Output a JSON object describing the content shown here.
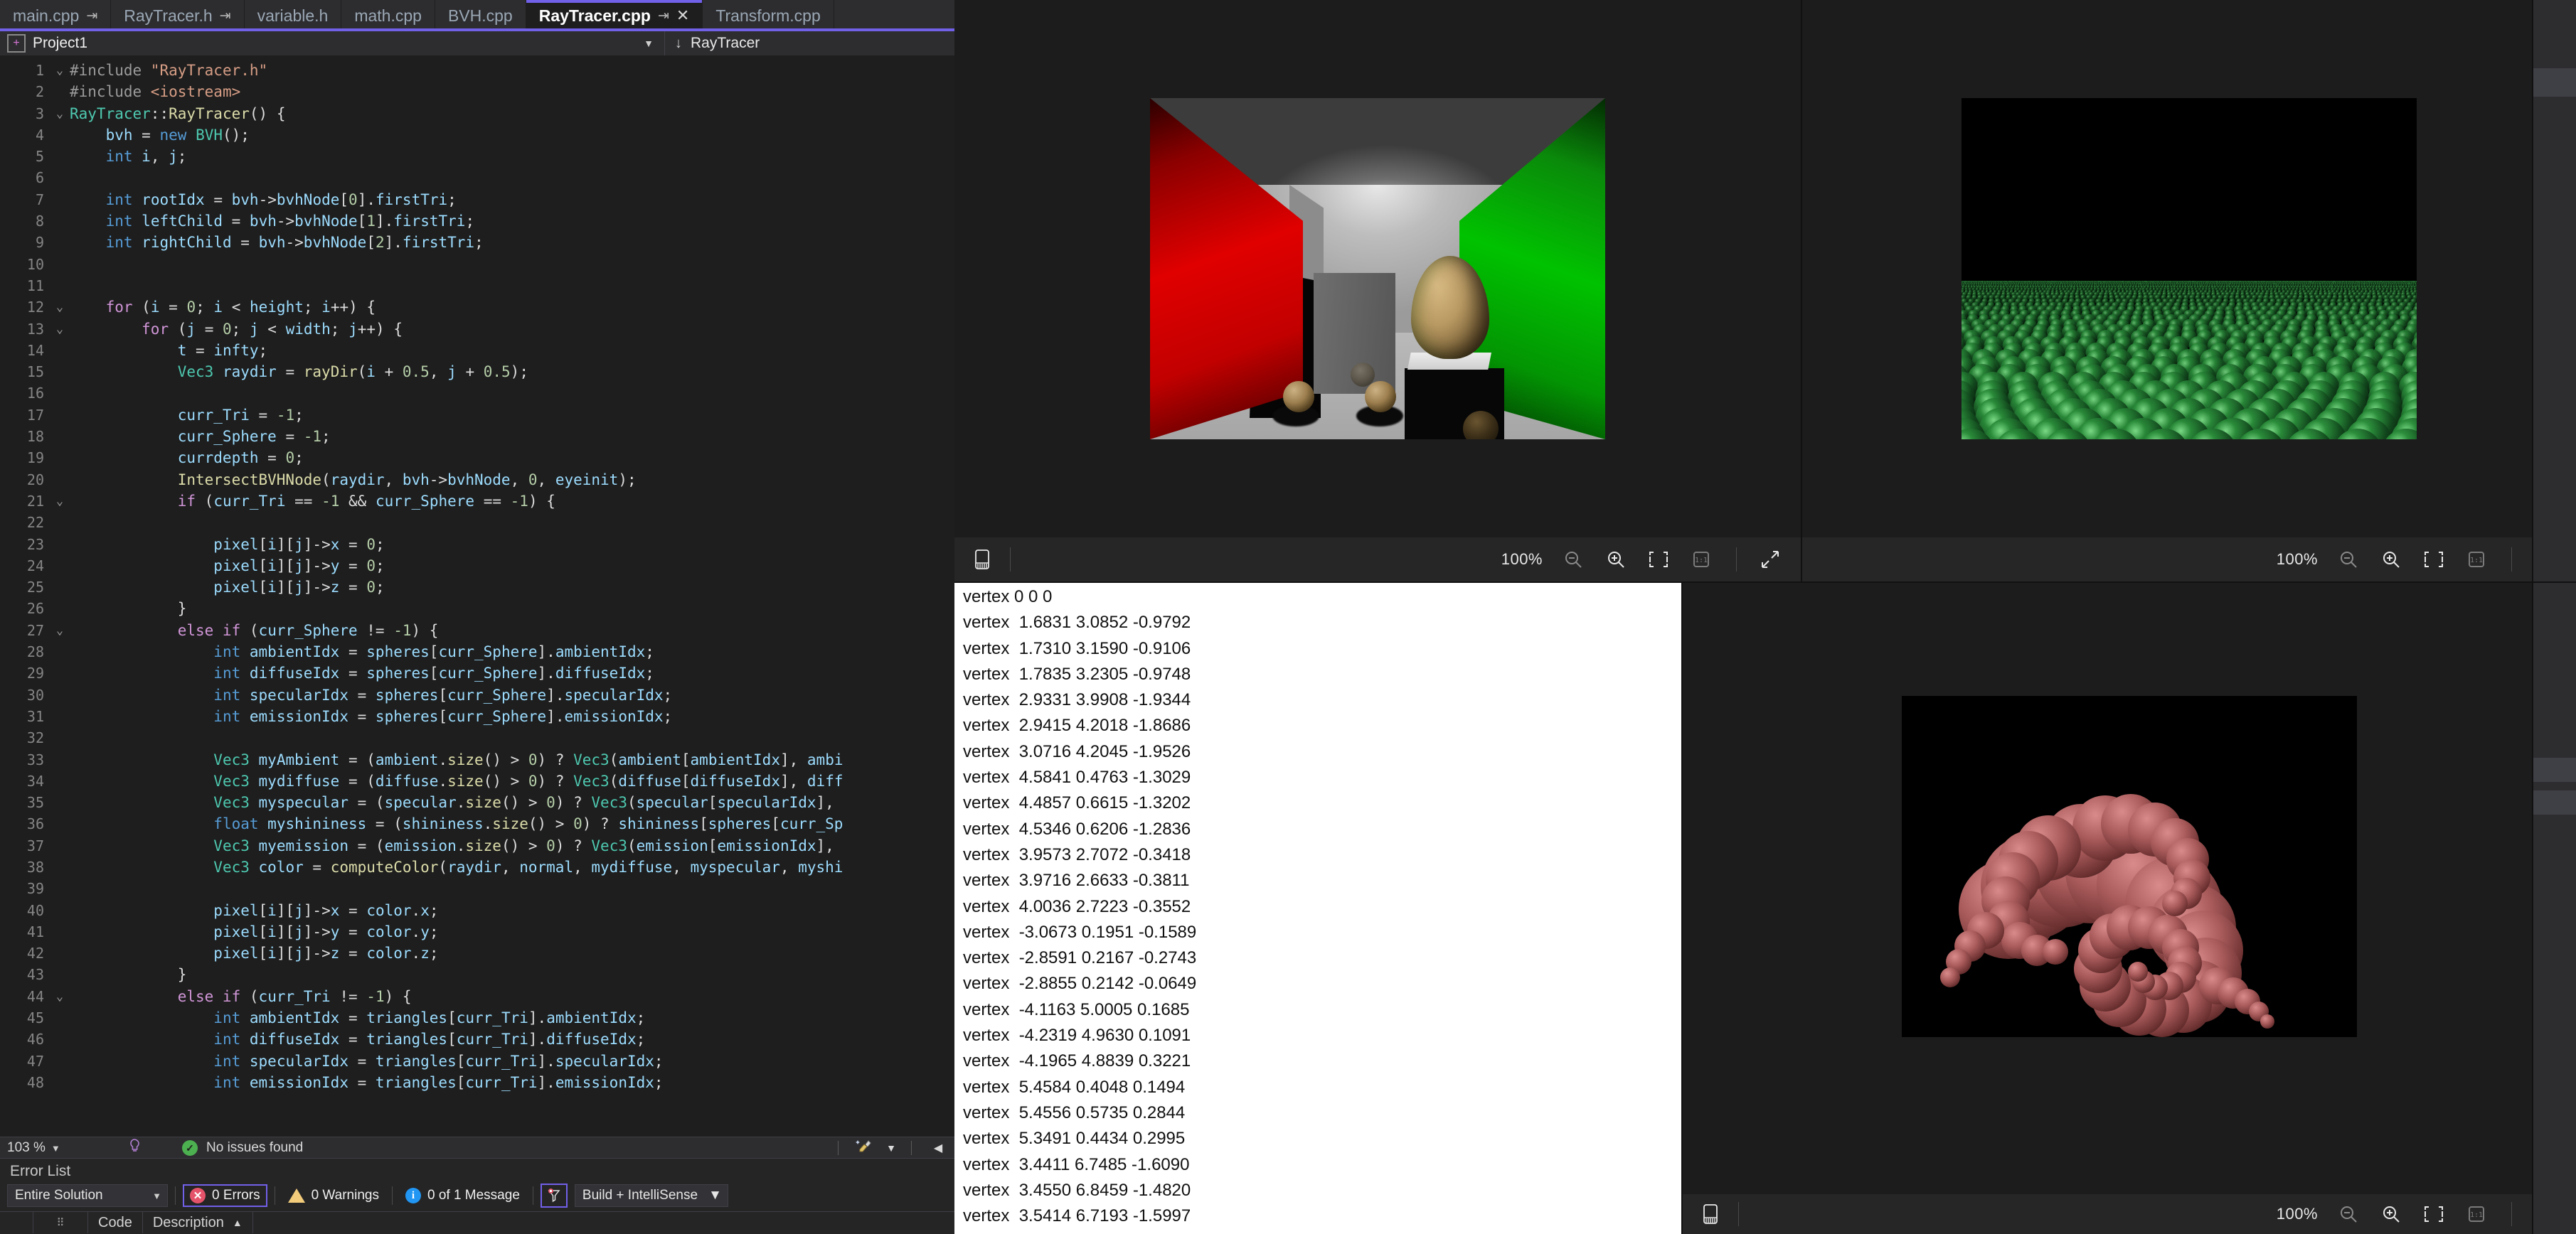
{
  "ide": {
    "tabs": [
      {
        "label": "main.cpp",
        "pinned": true,
        "active": false
      },
      {
        "label": "RayTracer.h",
        "pinned": true,
        "active": false
      },
      {
        "label": "variable.h",
        "pinned": false,
        "active": false
      },
      {
        "label": "math.cpp",
        "pinned": false,
        "active": false
      },
      {
        "label": "BVH.cpp",
        "pinned": false,
        "active": false
      },
      {
        "label": "RayTracer.cpp",
        "pinned": true,
        "active": true,
        "closable": true
      },
      {
        "label": "Transform.cpp",
        "pinned": false,
        "active": false
      }
    ],
    "breadcrumb": {
      "project": "Project1",
      "member": "RayTracer",
      "member_icon": "down-arrow-icon",
      "project_icon": "add-project-icon",
      "dropdown_icon": "chevron-down-icon"
    },
    "status": {
      "zoom": "103 %",
      "zoom_caret": "▾",
      "intellisense_icon": "intellisense-icon",
      "issues_text": "No issues found",
      "ok_icon": "check-icon",
      "broom_icon": "code-cleanup-icon",
      "broom_caret": "▾",
      "nav_back_icon": "chevron-left-icon"
    },
    "error_list": {
      "title": "Error List",
      "scope": "Entire Solution",
      "errors": "0 Errors",
      "warnings": "0 Warnings",
      "messages": "0 of 1 Message",
      "filter_icon": "filter-icon",
      "source": "Build + IntelliSense",
      "columns": [
        "",
        "",
        "Code",
        "Description"
      ],
      "sort_indicator": "▲",
      "rows": []
    },
    "code": {
      "lines": [
        {
          "n": 1,
          "fold": "v",
          "html": "<span class='pp'>#include </span><span class='st'>\"RayTracer.h\"</span>"
        },
        {
          "n": 2,
          "fold": "",
          "html": "<span class='pp'>#include </span><span class='st'>&lt;iostream&gt;</span>"
        },
        {
          "n": 3,
          "fold": "v",
          "html": "<span class='ty'>RayTracer</span><span class='pl'>::</span><span class='fn'>RayTracer</span><span class='pl'>() {</span>"
        },
        {
          "n": 4,
          "fold": "",
          "html": "    <span class='id'>bvh</span> <span class='pl'>= </span><span class='k'>new</span> <span class='ty'>BVH</span><span class='pl'>();</span>"
        },
        {
          "n": 5,
          "fold": "",
          "html": "    <span class='k'>int</span> <span class='id'>i</span><span class='pl'>, </span><span class='id'>j</span><span class='pl'>;</span>"
        },
        {
          "n": 6,
          "fold": "",
          "html": ""
        },
        {
          "n": 7,
          "fold": "",
          "html": "    <span class='k'>int</span> <span class='id'>rootIdx</span> <span class='pl'>= </span><span class='id'>bvh</span><span class='pl'>-&gt;</span><span class='id'>bvhNode</span><span class='pl'>[</span><span class='nu'>0</span><span class='pl'>].</span><span class='id'>firstTri</span><span class='pl'>;</span>"
        },
        {
          "n": 8,
          "fold": "",
          "html": "    <span class='k'>int</span> <span class='id'>leftChild</span> <span class='pl'>= </span><span class='id'>bvh</span><span class='pl'>-&gt;</span><span class='id'>bvhNode</span><span class='pl'>[</span><span class='nu'>1</span><span class='pl'>].</span><span class='id'>firstTri</span><span class='pl'>;</span>"
        },
        {
          "n": 9,
          "fold": "",
          "html": "    <span class='k'>int</span> <span class='id'>rightChild</span> <span class='pl'>= </span><span class='id'>bvh</span><span class='pl'>-&gt;</span><span class='id'>bvhNode</span><span class='pl'>[</span><span class='nu'>2</span><span class='pl'>].</span><span class='id'>firstTri</span><span class='pl'>;</span>"
        },
        {
          "n": 10,
          "fold": "",
          "html": ""
        },
        {
          "n": 11,
          "fold": "",
          "html": ""
        },
        {
          "n": 12,
          "fold": "v",
          "html": "    <span class='kw'>for</span> <span class='pl'>(</span><span class='id'>i</span> <span class='pl'>= </span><span class='nu'>0</span><span class='pl'>; </span><span class='id'>i</span> <span class='pl'>&lt; </span><span class='id'>height</span><span class='pl'>; </span><span class='id'>i</span><span class='pl'>++) {</span>"
        },
        {
          "n": 13,
          "fold": "v",
          "html": "        <span class='kw'>for</span> <span class='pl'>(</span><span class='id'>j</span> <span class='pl'>= </span><span class='nu'>0</span><span class='pl'>; </span><span class='id'>j</span> <span class='pl'>&lt; </span><span class='id'>width</span><span class='pl'>; </span><span class='id'>j</span><span class='pl'>++) {</span>"
        },
        {
          "n": 14,
          "fold": "",
          "html": "            <span class='id'>t</span> <span class='pl'>= </span><span class='id'>infty</span><span class='pl'>;</span>"
        },
        {
          "n": 15,
          "fold": "",
          "html": "            <span class='ty'>Vec3</span> <span class='id'>raydir</span> <span class='pl'>= </span><span class='fn'>rayDir</span><span class='pl'>(</span><span class='id'>i</span> <span class='pl'>+ </span><span class='nu'>0.5</span><span class='pl'>, </span><span class='id'>j</span> <span class='pl'>+ </span><span class='nu'>0.5</span><span class='pl'>);</span>"
        },
        {
          "n": 16,
          "fold": "",
          "html": ""
        },
        {
          "n": 17,
          "fold": "",
          "html": "            <span class='id'>curr_Tri</span> <span class='pl'>= </span><span class='nu'>-1</span><span class='pl'>;</span>"
        },
        {
          "n": 18,
          "fold": "",
          "html": "            <span class='id'>curr_Sphere</span> <span class='pl'>= </span><span class='nu'>-1</span><span class='pl'>;</span>"
        },
        {
          "n": 19,
          "fold": "",
          "html": "            <span class='id'>currdepth</span> <span class='pl'>= </span><span class='nu'>0</span><span class='pl'>;</span>"
        },
        {
          "n": 20,
          "fold": "",
          "html": "            <span class='fn'>IntersectBVHNode</span><span class='pl'>(</span><span class='id'>raydir</span><span class='pl'>, </span><span class='id'>bvh</span><span class='pl'>-&gt;</span><span class='id'>bvhNode</span><span class='pl'>, </span><span class='nu'>0</span><span class='pl'>, </span><span class='id'>eyeinit</span><span class='pl'>);</span>"
        },
        {
          "n": 21,
          "fold": "v",
          "html": "            <span class='kw'>if</span> <span class='pl'>(</span><span class='id'>curr_Tri</span> <span class='pl'>== </span><span class='nu'>-1</span> <span class='pl'>&amp;&amp; </span><span class='id'>curr_Sphere</span> <span class='pl'>== </span><span class='nu'>-1</span><span class='pl'>) {</span>"
        },
        {
          "n": 22,
          "fold": "",
          "html": ""
        },
        {
          "n": 23,
          "fold": "",
          "html": "                <span class='id'>pixel</span><span class='pl'>[</span><span class='id'>i</span><span class='pl'>][</span><span class='id'>j</span><span class='pl'>]-&gt;</span><span class='id'>x</span> <span class='pl'>= </span><span class='nu'>0</span><span class='pl'>;</span>"
        },
        {
          "n": 24,
          "fold": "",
          "html": "                <span class='id'>pixel</span><span class='pl'>[</span><span class='id'>i</span><span class='pl'>][</span><span class='id'>j</span><span class='pl'>]-&gt;</span><span class='id'>y</span> <span class='pl'>= </span><span class='nu'>0</span><span class='pl'>;</span>"
        },
        {
          "n": 25,
          "fold": "",
          "html": "                <span class='id'>pixel</span><span class='pl'>[</span><span class='id'>i</span><span class='pl'>][</span><span class='id'>j</span><span class='pl'>]-&gt;</span><span class='id'>z</span> <span class='pl'>= </span><span class='nu'>0</span><span class='pl'>;</span>"
        },
        {
          "n": 26,
          "fold": "",
          "html": "            <span class='pl'>}</span>"
        },
        {
          "n": 27,
          "fold": "v",
          "html": "            <span class='kw'>else if</span> <span class='pl'>(</span><span class='id'>curr_Sphere</span> <span class='pl'>!= </span><span class='nu'>-1</span><span class='pl'>) {</span>"
        },
        {
          "n": 28,
          "fold": "",
          "html": "                <span class='k'>int</span> <span class='id'>ambientIdx</span> <span class='pl'>= </span><span class='id'>spheres</span><span class='pl'>[</span><span class='id'>curr_Sphere</span><span class='pl'>].</span><span class='id'>ambientIdx</span><span class='pl'>;</span>"
        },
        {
          "n": 29,
          "fold": "",
          "html": "                <span class='k'>int</span> <span class='id'>diffuseIdx</span> <span class='pl'>= </span><span class='id'>spheres</span><span class='pl'>[</span><span class='id'>curr_Sphere</span><span class='pl'>].</span><span class='id'>diffuseIdx</span><span class='pl'>;</span>"
        },
        {
          "n": 30,
          "fold": "",
          "html": "                <span class='k'>int</span> <span class='id'>specularIdx</span> <span class='pl'>= </span><span class='id'>spheres</span><span class='pl'>[</span><span class='id'>curr_Sphere</span><span class='pl'>].</span><span class='id'>specularIdx</span><span class='pl'>;</span>"
        },
        {
          "n": 31,
          "fold": "",
          "html": "                <span class='k'>int</span> <span class='id'>emissionIdx</span> <span class='pl'>= </span><span class='id'>spheres</span><span class='pl'>[</span><span class='id'>curr_Sphere</span><span class='pl'>].</span><span class='id'>emissionIdx</span><span class='pl'>;</span>"
        },
        {
          "n": 32,
          "fold": "",
          "html": ""
        },
        {
          "n": 33,
          "fold": "",
          "html": "                <span class='ty'>Vec3</span> <span class='id'>myAmbient</span> <span class='pl'>= (</span><span class='id'>ambient</span><span class='pl'>.</span><span class='fn'>size</span><span class='pl'>() &gt; </span><span class='nu'>0</span><span class='pl'>) ? </span><span class='ty'>Vec3</span><span class='pl'>(</span><span class='id'>ambient</span><span class='pl'>[</span><span class='id'>ambientIdx</span><span class='pl'>], </span><span class='id'>ambi</span>"
        },
        {
          "n": 34,
          "fold": "",
          "html": "                <span class='ty'>Vec3</span> <span class='id'>mydiffuse</span> <span class='pl'>= (</span><span class='id'>diffuse</span><span class='pl'>.</span><span class='fn'>size</span><span class='pl'>() &gt; </span><span class='nu'>0</span><span class='pl'>) ? </span><span class='ty'>Vec3</span><span class='pl'>(</span><span class='id'>diffuse</span><span class='pl'>[</span><span class='id'>diffuseIdx</span><span class='pl'>], </span><span class='id'>diff</span>"
        },
        {
          "n": 35,
          "fold": "",
          "html": "                <span class='ty'>Vec3</span> <span class='id'>myspecular</span> <span class='pl'>= (</span><span class='id'>specular</span><span class='pl'>.</span><span class='fn'>size</span><span class='pl'>() &gt; </span><span class='nu'>0</span><span class='pl'>) ? </span><span class='ty'>Vec3</span><span class='pl'>(</span><span class='id'>specular</span><span class='pl'>[</span><span class='id'>specularIdx</span><span class='pl'>], </span>"
        },
        {
          "n": 36,
          "fold": "",
          "html": "                <span class='k'>float</span> <span class='id'>myshininess</span> <span class='pl'>= (</span><span class='id'>shininess</span><span class='pl'>.</span><span class='fn'>size</span><span class='pl'>() &gt; </span><span class='nu'>0</span><span class='pl'>) ? </span><span class='id'>shininess</span><span class='pl'>[</span><span class='id'>spheres</span><span class='pl'>[</span><span class='id'>curr_Sp</span>"
        },
        {
          "n": 37,
          "fold": "",
          "html": "                <span class='ty'>Vec3</span> <span class='id'>myemission</span> <span class='pl'>= (</span><span class='id'>emission</span><span class='pl'>.</span><span class='fn'>size</span><span class='pl'>() &gt; </span><span class='nu'>0</span><span class='pl'>) ? </span><span class='ty'>Vec3</span><span class='pl'>(</span><span class='id'>emission</span><span class='pl'>[</span><span class='id'>emissionIdx</span><span class='pl'>], </span>"
        },
        {
          "n": 38,
          "fold": "",
          "html": "                <span class='ty'>Vec3</span> <span class='id'>color</span> <span class='pl'>= </span><span class='fn'>computeColor</span><span class='pl'>(</span><span class='id'>raydir</span><span class='pl'>, </span><span class='id'>normal</span><span class='pl'>, </span><span class='id'>mydiffuse</span><span class='pl'>, </span><span class='id'>myspecular</span><span class='pl'>, </span><span class='id'>myshi</span>"
        },
        {
          "n": 39,
          "fold": "",
          "html": ""
        },
        {
          "n": 40,
          "fold": "",
          "html": "                <span class='id'>pixel</span><span class='pl'>[</span><span class='id'>i</span><span class='pl'>][</span><span class='id'>j</span><span class='pl'>]-&gt;</span><span class='id'>x</span> <span class='pl'>= </span><span class='id'>color</span><span class='pl'>.</span><span class='id'>x</span><span class='pl'>;</span>"
        },
        {
          "n": 41,
          "fold": "",
          "html": "                <span class='id'>pixel</span><span class='pl'>[</span><span class='id'>i</span><span class='pl'>][</span><span class='id'>j</span><span class='pl'>]-&gt;</span><span class='id'>y</span> <span class='pl'>= </span><span class='id'>color</span><span class='pl'>.</span><span class='id'>y</span><span class='pl'>;</span>"
        },
        {
          "n": 42,
          "fold": "",
          "html": "                <span class='id'>pixel</span><span class='pl'>[</span><span class='id'>i</span><span class='pl'>][</span><span class='id'>j</span><span class='pl'>]-&gt;</span><span class='id'>z</span> <span class='pl'>= </span><span class='id'>color</span><span class='pl'>.</span><span class='id'>z</span><span class='pl'>;</span>"
        },
        {
          "n": 43,
          "fold": "",
          "html": "            <span class='pl'>}</span>"
        },
        {
          "n": 44,
          "fold": "v",
          "html": "            <span class='kw'>else if</span> <span class='pl'>(</span><span class='id'>curr_Tri</span> <span class='pl'>!= </span><span class='nu'>-1</span><span class='pl'>) {</span>"
        },
        {
          "n": 45,
          "fold": "",
          "html": "                <span class='k'>int</span> <span class='id'>ambientIdx</span> <span class='pl'>= </span><span class='id'>triangles</span><span class='pl'>[</span><span class='id'>curr_Tri</span><span class='pl'>].</span><span class='id'>ambientIdx</span><span class='pl'>;</span>"
        },
        {
          "n": 46,
          "fold": "",
          "html": "                <span class='k'>int</span> <span class='id'>diffuseIdx</span> <span class='pl'>= </span><span class='id'>triangles</span><span class='pl'>[</span><span class='id'>curr_Tri</span><span class='pl'>].</span><span class='id'>diffuseIdx</span><span class='pl'>;</span>"
        },
        {
          "n": 47,
          "fold": "",
          "html": "                <span class='k'>int</span> <span class='id'>specularIdx</span> <span class='pl'>= </span><span class='id'>triangles</span><span class='pl'>[</span><span class='id'>curr_Tri</span><span class='pl'>].</span><span class='id'>specularIdx</span><span class='pl'>;</span>"
        },
        {
          "n": 48,
          "fold": "",
          "html": "                <span class='k'>int</span> <span class='id'>emissionIdx</span> <span class='pl'>= </span><span class='id'>triangles</span><span class='pl'>[</span><span class='id'>curr_Tri</span><span class='pl'>].</span><span class='id'>emissionIdx</span><span class='pl'>;</span>"
        }
      ]
    }
  },
  "viewers": {
    "cornell": {
      "zoom": "100%",
      "name": "cornell-box-render",
      "icons": [
        "film-strip-icon",
        "zoom-out-icon",
        "zoom-in-icon",
        "fit-to-window-icon",
        "actual-size-icon",
        "expand-icon"
      ]
    },
    "spheres": {
      "zoom": "100%",
      "name": "sphere-field-render",
      "icons": [
        "film-strip-icon",
        "zoom-out-icon",
        "zoom-in-icon",
        "fit-to-window-icon",
        "actual-size-icon",
        "expand-icon"
      ]
    },
    "dragon": {
      "zoom": "100%",
      "name": "dragon-render",
      "icons": [
        "film-strip-icon",
        "zoom-out-icon",
        "zoom-in-icon",
        "fit-to-window-icon",
        "actual-size-icon",
        "expand-icon"
      ]
    },
    "vertex_list": {
      "name": "vertex-output-pane",
      "lines": [
        "vertex 0 0 0",
        "vertex  1.6831 3.0852 -0.9792",
        "vertex  1.7310 3.1590 -0.9106",
        "vertex  1.7835 3.2305 -0.9748",
        "vertex  2.9331 3.9908 -1.9344",
        "vertex  2.9415 4.2018 -1.8686",
        "vertex  3.0716 4.2045 -1.9526",
        "vertex  4.5841 0.4763 -1.3029",
        "vertex  4.4857 0.6615 -1.3202",
        "vertex  4.5346 0.6206 -1.2836",
        "vertex  3.9573 2.7072 -0.3418",
        "vertex  3.9716 2.6633 -0.3811",
        "vertex  4.0036 2.7223 -0.3552",
        "vertex  -3.0673 0.1951 -0.1589",
        "vertex  -2.8591 0.2167 -0.2743",
        "vertex  -2.8855 0.2142 -0.0649",
        "vertex  -4.1163 5.0005 0.1685",
        "vertex  -4.2319 4.9630 0.1091",
        "vertex  -4.1965 4.8839 0.3221",
        "vertex  5.4584 0.4048 0.1494",
        "vertex  5.4556 0.5735 0.2844",
        "vertex  5.3491 0.4434 0.2995",
        "vertex  3.4411 6.7485 -1.6090",
        "vertex  3.4550 6.8459 -1.4820",
        "vertex  3.5414 6.7193 -1.5997"
      ]
    }
  },
  "colors": {
    "accent_purple": "#7160e8",
    "editor_bg": "#1e1e1e",
    "chrome_bg": "#2d2d30",
    "error_red": "#e5536a",
    "warning_yellow": "#f2cc7a",
    "info_blue": "#2196f3",
    "ok_green": "#4caf50"
  }
}
